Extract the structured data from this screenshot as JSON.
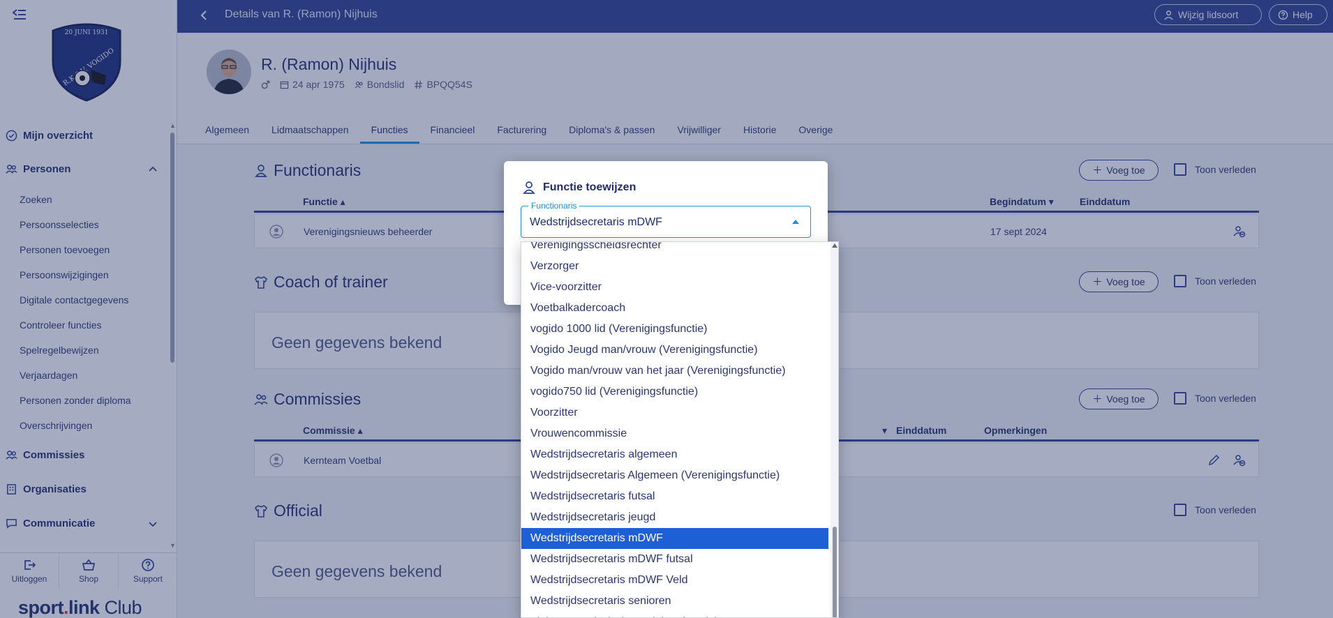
{
  "sidebar": {
    "logo_text_top": "20 JUNI 1931",
    "logo_text_ring": "R.K.S.V. VOGIDO",
    "mijn_overzicht": "Mijn overzicht",
    "personen": "Personen",
    "sub_items": [
      "Zoeken",
      "Persoonsselecties",
      "Personen toevoegen",
      "Persoonswijzigingen",
      "Digitale contactgegevens",
      "Controleer functies",
      "Spelregelbewijzen",
      "Verjaardagen",
      "Personen zonder diploma",
      "Overschrijvingen"
    ],
    "commissies": "Commissies",
    "organisaties": "Organisaties",
    "communicatie": "Communicatie",
    "bottom": {
      "uitloggen": "Uitloggen",
      "shop": "Shop",
      "support": "Support"
    },
    "brand": {
      "sport": "sport",
      "dot": ".",
      "link": "link",
      "club": " Club"
    }
  },
  "topbar": {
    "title": "Details van R. (Ramon) Nijhuis",
    "wijzig_lidsoort": "Wijzig lidsoort",
    "help": "Help"
  },
  "person": {
    "name": "R. (Ramon) Nijhuis",
    "birthdate": "24 apr 1975",
    "lidsoort": "Bondslid",
    "relatiecode": "BPQQ54S"
  },
  "tabs": [
    "Algemeen",
    "Lidmaatschappen",
    "Functies",
    "Financieel",
    "Facturering",
    "Diploma's & passen",
    "Vrijwilliger",
    "Historie",
    "Overige"
  ],
  "active_tab": "Functies",
  "sections": {
    "functionaris": {
      "title": "Functionaris",
      "voeg_toe": "Voeg toe",
      "toon_verleden": "Toon verleden",
      "columns": {
        "functie": "Functie",
        "begindatum": "Begindatum",
        "einddatum": "Einddatum"
      },
      "row": {
        "functie": "Verenigingsnieuws beheerder",
        "begindatum": "17 sept 2024"
      }
    },
    "coach": {
      "title": "Coach of trainer",
      "voeg_toe": "Voeg toe",
      "toon_verleden": "Toon verleden",
      "empty": "Geen gegevens bekend"
    },
    "commissies": {
      "title": "Commissies",
      "voeg_toe": "Voeg toe",
      "toon_verleden": "Toon verleden",
      "columns": {
        "commissie": "Commissie",
        "einddatum": "Einddatum",
        "opmerkingen": "Opmerkingen"
      },
      "row": {
        "commissie": "Kernteam Voetbal"
      }
    },
    "official": {
      "title": "Official",
      "toon_verleden": "Toon verleden",
      "empty": "Geen gegevens bekend"
    }
  },
  "modal": {
    "title": "Functie toewijzen",
    "field_label": "Functionaris",
    "selected_value": "Wedstrijdsecretaris mDWF"
  },
  "dropdown": {
    "items": [
      "Verenigingsscheidsrechter",
      "Verzorger",
      "Vice-voorzitter",
      "Voetbalkadercoach",
      "vogido 1000 lid (Verenigingsfunctie)",
      "Vogido Jeugd man/vrouw (Verenigingsfunctie)",
      "Vogido man/vrouw van het jaar (Verenigingsfunctie)",
      "vogido750 lid (Verenigingsfunctie)",
      "Voorzitter",
      "Vrouwencommissie",
      "Wedstrijdsecretaris algemeen",
      "Wedstrijdsecretaris Algemeen (Verenigingsfunctie)",
      "Wedstrijdsecretaris futsal",
      "Wedstrijdsecretaris jeugd",
      "Wedstrijdsecretaris mDWF",
      "Wedstrijdsecretaris mDWF futsal",
      "Wedstrijdsecretaris mDWF Veld",
      "Wedstrijdsecretaris senioren",
      "Ziekencommissie (Verenigingsfunctie)"
    ],
    "selected_index": 14
  },
  "colors": {
    "primary": "#2b3f8f",
    "accent": "#1d8fe1",
    "selected": "#1f5fd6"
  }
}
